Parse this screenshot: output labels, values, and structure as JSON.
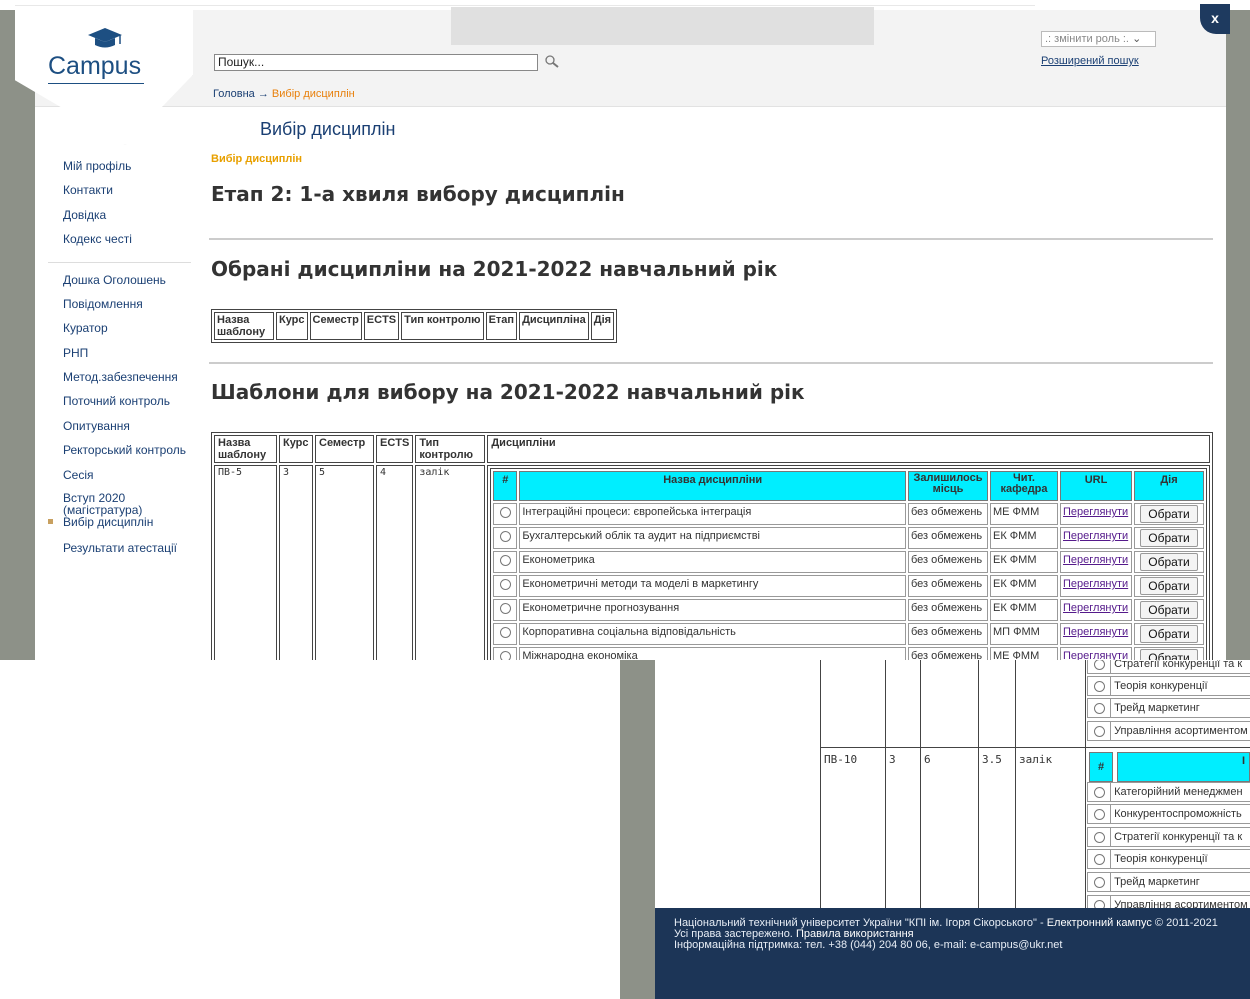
{
  "header": {
    "logo_text": "Campus",
    "search_placeholder": "Пошук...",
    "role_select": ".: змінити роль :.",
    "advanced_search": "Розширений пошук",
    "close_label": "x"
  },
  "breadcrumb": {
    "home": "Головна",
    "arrow": "→",
    "current": "Вибір дисциплін"
  },
  "page": {
    "title": "Вибір дисциплін",
    "subtitle": "Вибір дисциплін",
    "stage": "Етап 2: 1-а хвиля вибору дисциплін",
    "selected_heading": "Обрані дисципліни на 2021-2022 навчальний рік",
    "templates_heading": "Шаблони для вибору на 2021-2022 навчальний рік"
  },
  "sidebar": {
    "items": [
      "Мій профіль",
      "Контакти",
      "Довідка",
      "Кодекс честі",
      "Дошка Оголошень",
      "Повідомлення",
      "Куратор",
      "РНП",
      "Метод.забезпечення",
      "Поточний контроль",
      "Опитування",
      "Ректорський контроль",
      "Сесія",
      "Вступ 2020 (магістратура)",
      "Вибір дисциплін",
      "Результати атестації"
    ]
  },
  "selected_table": {
    "headers": [
      "Назва шаблону",
      "Курс",
      "Семестр",
      "ECTS",
      "Тип контролю",
      "Етап",
      "Дисципліна",
      "Дія"
    ]
  },
  "templates_table": {
    "headers": [
      "Назва шаблону",
      "Курс",
      "Семестр",
      "ECTS",
      "Тип контролю",
      "Дисципліни"
    ],
    "row1": {
      "name": "ПВ-5",
      "course": "3",
      "semester": "5",
      "ects": "4",
      "control": "залік"
    },
    "inner_headers": [
      "#",
      "Назва дисципліни",
      "Залишилось місць",
      "Чит. кафедра",
      "URL",
      "Дія"
    ],
    "inner_rows": [
      {
        "name": "Інтеграційні процеси: європейська інтеграція",
        "seats": "без обмежень",
        "dept": "МЕ ФММ",
        "url": "Переглянути",
        "action": "Обрати"
      },
      {
        "name": "Бухгалтерський облік та аудит на підприємстві",
        "seats": "без обмежень",
        "dept": "ЕК ФММ",
        "url": "Переглянути",
        "action": "Обрати"
      },
      {
        "name": "Економетрика",
        "seats": "без обмежень",
        "dept": "ЕК ФММ",
        "url": "Переглянути",
        "action": "Обрати"
      },
      {
        "name": "Економетричні методи та моделі в маркетингу",
        "seats": "без обмежень",
        "dept": "ЕК ФММ",
        "url": "Переглянути",
        "action": "Обрати"
      },
      {
        "name": "Економетричне прогнозування",
        "seats": "без обмежень",
        "dept": "ЕК ФММ",
        "url": "Переглянути",
        "action": "Обрати"
      },
      {
        "name": "Корпоративна соціальна відповідальність",
        "seats": "без обмежень",
        "dept": "МП ФММ",
        "url": "Переглянути",
        "action": "Обрати"
      },
      {
        "name": "Міжнародна економіка",
        "seats": "без обмежень",
        "dept": "МЕ ФММ",
        "url": "Переглянути",
        "action": "Обрати"
      }
    ]
  },
  "lower": {
    "top_rows": [
      "Стратегії конкуренції та к",
      "Теорія конкуренції",
      "Трейд маркетинг",
      "Управління асортиментом"
    ],
    "row2": {
      "name": "ПВ-10",
      "course": "3",
      "semester": "6",
      "ects": "3.5",
      "control": "залік"
    },
    "header_hash": "#",
    "header_partial": "І",
    "rows": [
      "Категорійний менеджмен",
      "Конкурентоспроможність",
      "Стратегії конкуренції та к",
      "Теорія конкуренції",
      "Трейд маркетинг",
      "Управління асортиментом"
    ]
  },
  "footer": {
    "line1a": "Національний технічний університет України \"КПІ ім. Ігоря Сікорського\" - ",
    "line1b": "Електронний кампус",
    "line1c": " © 2011-2021",
    "line2a": "Усі права застережено. ",
    "line2b": "Правила використання",
    "line3": "Інформаційна підтримка: тел. +38 (044) 204 80 06, e-mail:  e-campus@ukr.net"
  }
}
